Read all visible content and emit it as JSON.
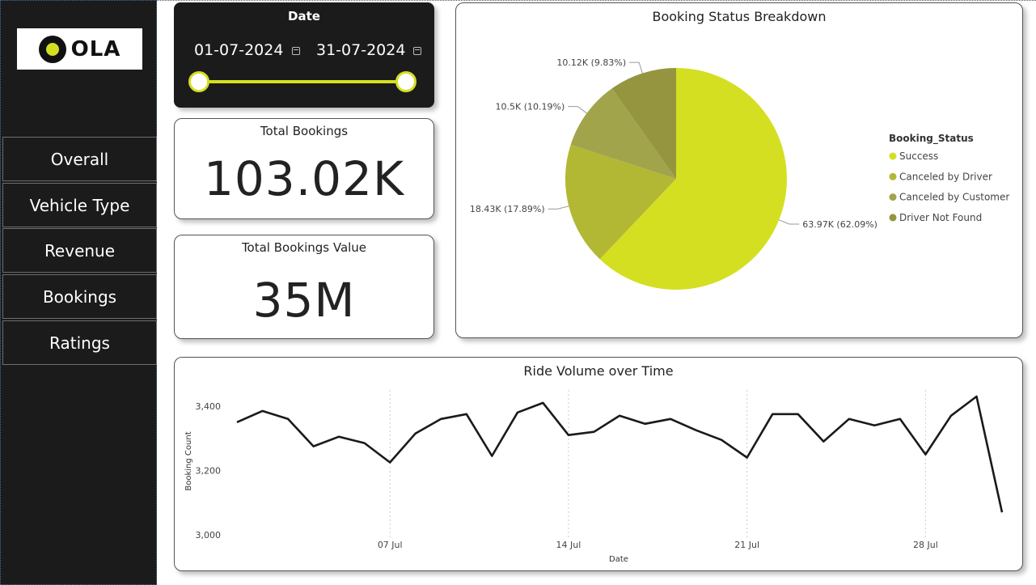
{
  "brand": {
    "logo_text": "OLA"
  },
  "sidebar": {
    "items": [
      {
        "label": "Overall"
      },
      {
        "label": "Vehicle Type"
      },
      {
        "label": "Revenue"
      },
      {
        "label": "Bookings"
      },
      {
        "label": "Ratings"
      }
    ]
  },
  "date_filter": {
    "title": "Date",
    "start": "01-07-2024",
    "end": "31-07-2024"
  },
  "kpis": {
    "total_bookings": {
      "title": "Total Bookings",
      "value": "103.02K"
    },
    "total_value": {
      "title": "Total Bookings Value",
      "value": "35M"
    }
  },
  "colors": {
    "accent": "#d4df22",
    "sidebar": "#1b1b1b",
    "line": "#1a1a1a"
  },
  "chart_data": [
    {
      "type": "pie",
      "title": "Booking Status Breakdown",
      "legend_title": "Booking_Status",
      "legend_position": "right",
      "slices": [
        {
          "name": "Success",
          "value": 63970,
          "label": "63.97K (62.09%)",
          "color": "#d4df22"
        },
        {
          "name": "Canceled by Driver",
          "value": 18430,
          "label": "18.43K (17.89%)",
          "color": "#b2b833"
        },
        {
          "name": "Canceled by Customer",
          "value": 10500,
          "label": "10.5K (10.19%)",
          "color": "#a1a44a"
        },
        {
          "name": "Driver Not Found",
          "value": 10120,
          "label": "10.12K (9.83%)",
          "color": "#94953e"
        }
      ]
    },
    {
      "type": "line",
      "title": "Ride Volume over Time",
      "xlabel": "Date",
      "ylabel": "Booking Count",
      "ylim": [
        3000,
        3450
      ],
      "yticks": [
        "3,000",
        "3,200",
        "3,400"
      ],
      "ytick_values": [
        3000,
        3200,
        3400
      ],
      "xticks": [
        "07 Jul",
        "14 Jul",
        "21 Jul",
        "28 Jul"
      ],
      "xtick_days": [
        7,
        14,
        21,
        28
      ],
      "grid": "vertical dotted at x ticks",
      "x": [
        1,
        2,
        3,
        4,
        5,
        6,
        7,
        8,
        9,
        10,
        11,
        12,
        13,
        14,
        15,
        16,
        17,
        18,
        19,
        20,
        21,
        22,
        23,
        24,
        25,
        26,
        27,
        28,
        29,
        30,
        31
      ],
      "values": [
        3350,
        3385,
        3360,
        3275,
        3305,
        3285,
        3225,
        3315,
        3360,
        3375,
        3245,
        3380,
        3410,
        3310,
        3320,
        3370,
        3345,
        3360,
        3325,
        3295,
        3240,
        3375,
        3375,
        3290,
        3360,
        3340,
        3360,
        3250,
        3370,
        3430,
        3070
      ]
    }
  ]
}
